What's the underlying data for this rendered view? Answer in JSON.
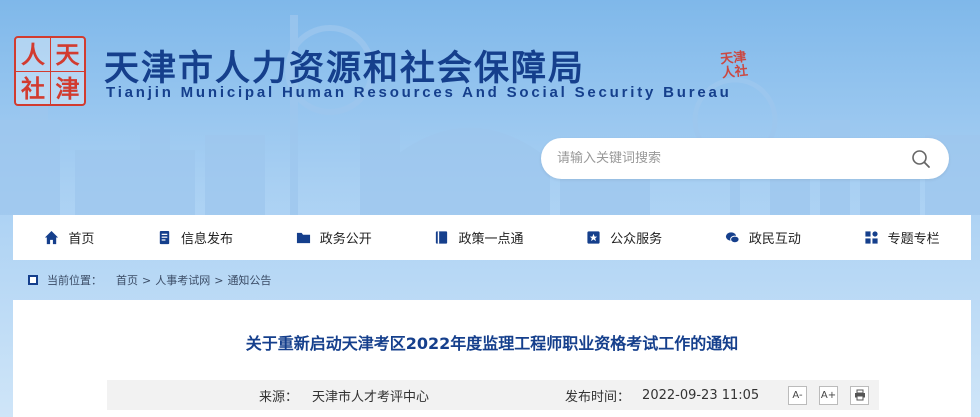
{
  "header": {
    "logo_chars": [
      "人",
      "天",
      "社",
      "津"
    ],
    "title": "天津市人力资源和社会保障局",
    "subtitle": "Tianjin Municipal Human Resources And Social Security Bureau",
    "stamp_text": [
      "天津",
      "人社"
    ]
  },
  "search": {
    "placeholder": "请输入关键词搜索",
    "icon": "search-icon"
  },
  "nav": {
    "items": [
      {
        "label": "首页",
        "icon": "home-icon"
      },
      {
        "label": "信息发布",
        "icon": "document-icon"
      },
      {
        "label": "政务公开",
        "icon": "folder-icon"
      },
      {
        "label": "政策一点通",
        "icon": "book-icon"
      },
      {
        "label": "公众服务",
        "icon": "star-badge-icon"
      },
      {
        "label": "政民互动",
        "icon": "chat-icon"
      },
      {
        "label": "专题专栏",
        "icon": "grid-icon"
      }
    ]
  },
  "breadcrumb": {
    "label": "当前位置：",
    "items": [
      "首页",
      "人事考试网",
      "通知公告"
    ],
    "separator": ">"
  },
  "article": {
    "title": "关于重新启动天津考区2022年度监理工程师职业资格考试工作的通知",
    "source_label": "来源：",
    "source_value": "天津市人才考评中心",
    "time_label": "发布时间：",
    "time_value": "2022-09-23 11:05",
    "tools": [
      {
        "label": "A-",
        "icon": "font-decrease-icon"
      },
      {
        "label": "A+",
        "icon": "font-increase-icon"
      },
      {
        "label": "",
        "icon": "print-icon"
      }
    ]
  },
  "colors": {
    "brand_blue": "#153f8c",
    "seal_red": "#d23b2f",
    "sky_top": "#7fb8ea"
  }
}
